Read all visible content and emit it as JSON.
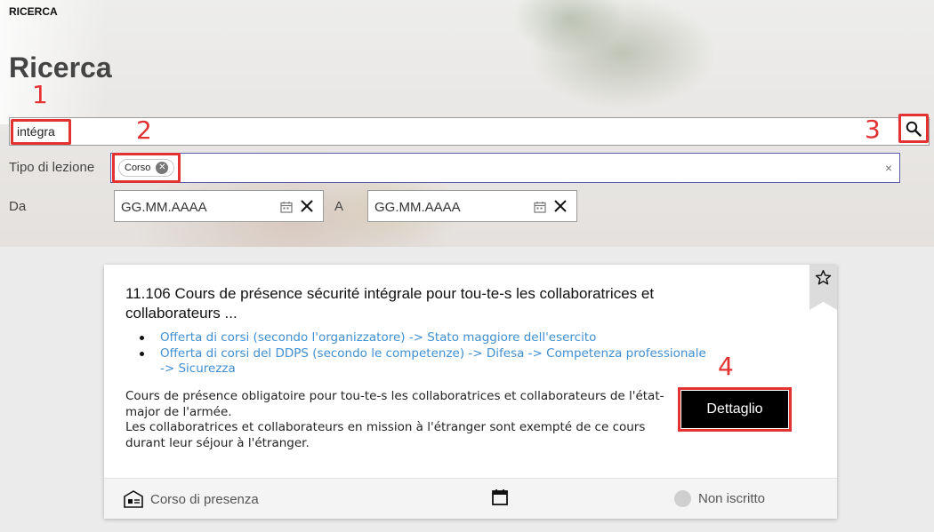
{
  "app": {
    "title": "RICERCA"
  },
  "page": {
    "title": "Ricerca"
  },
  "search": {
    "value": "intégra",
    "placeholder": ""
  },
  "filters": {
    "type_label": "Tipo di lezione",
    "type_chip": "Corso",
    "clear_symbol": "×",
    "from_label": "Da",
    "to_label": "A",
    "date_placeholder": "GG.MM.AAAA"
  },
  "annotations": {
    "n1": "1",
    "n2": "2",
    "n3": "3",
    "n4": "4"
  },
  "result": {
    "title": "11.106 Cours de présence sécurité intégrale pour tou-te-s les collaboratrices et collaborateurs ...",
    "links": [
      "Offerta di corsi (secondo l'organizzatore) -> Stato maggiore dell'esercito",
      "Offerta di corsi del DDPS (secondo le competenze) -> Difesa -> Competenza professionale -> Sicurezza"
    ],
    "description_1": "Cours de présence obligatoire pour tou-te-s les collaboratrices et collaborateurs de l'état-major de l'armée.",
    "description_2": "Les collaboratrices et collaborateurs en mission à l'étranger sont exempté de ce cours durant leur séjour à l'étranger.",
    "detail_button": "Dettaglio",
    "footer": {
      "format": "Corso di presenza",
      "status": "Non iscritto"
    }
  },
  "icons": {
    "search": "search-icon",
    "favorite": "star-icon",
    "calendar": "calendar-icon",
    "format": "presence-course-icon",
    "status": "status-dot-icon"
  },
  "colors": {
    "accent_link": "#3f8fd2",
    "annotation_red": "#e33232",
    "button_bg": "#000000",
    "field_focus_border": "#5a5aa8"
  }
}
